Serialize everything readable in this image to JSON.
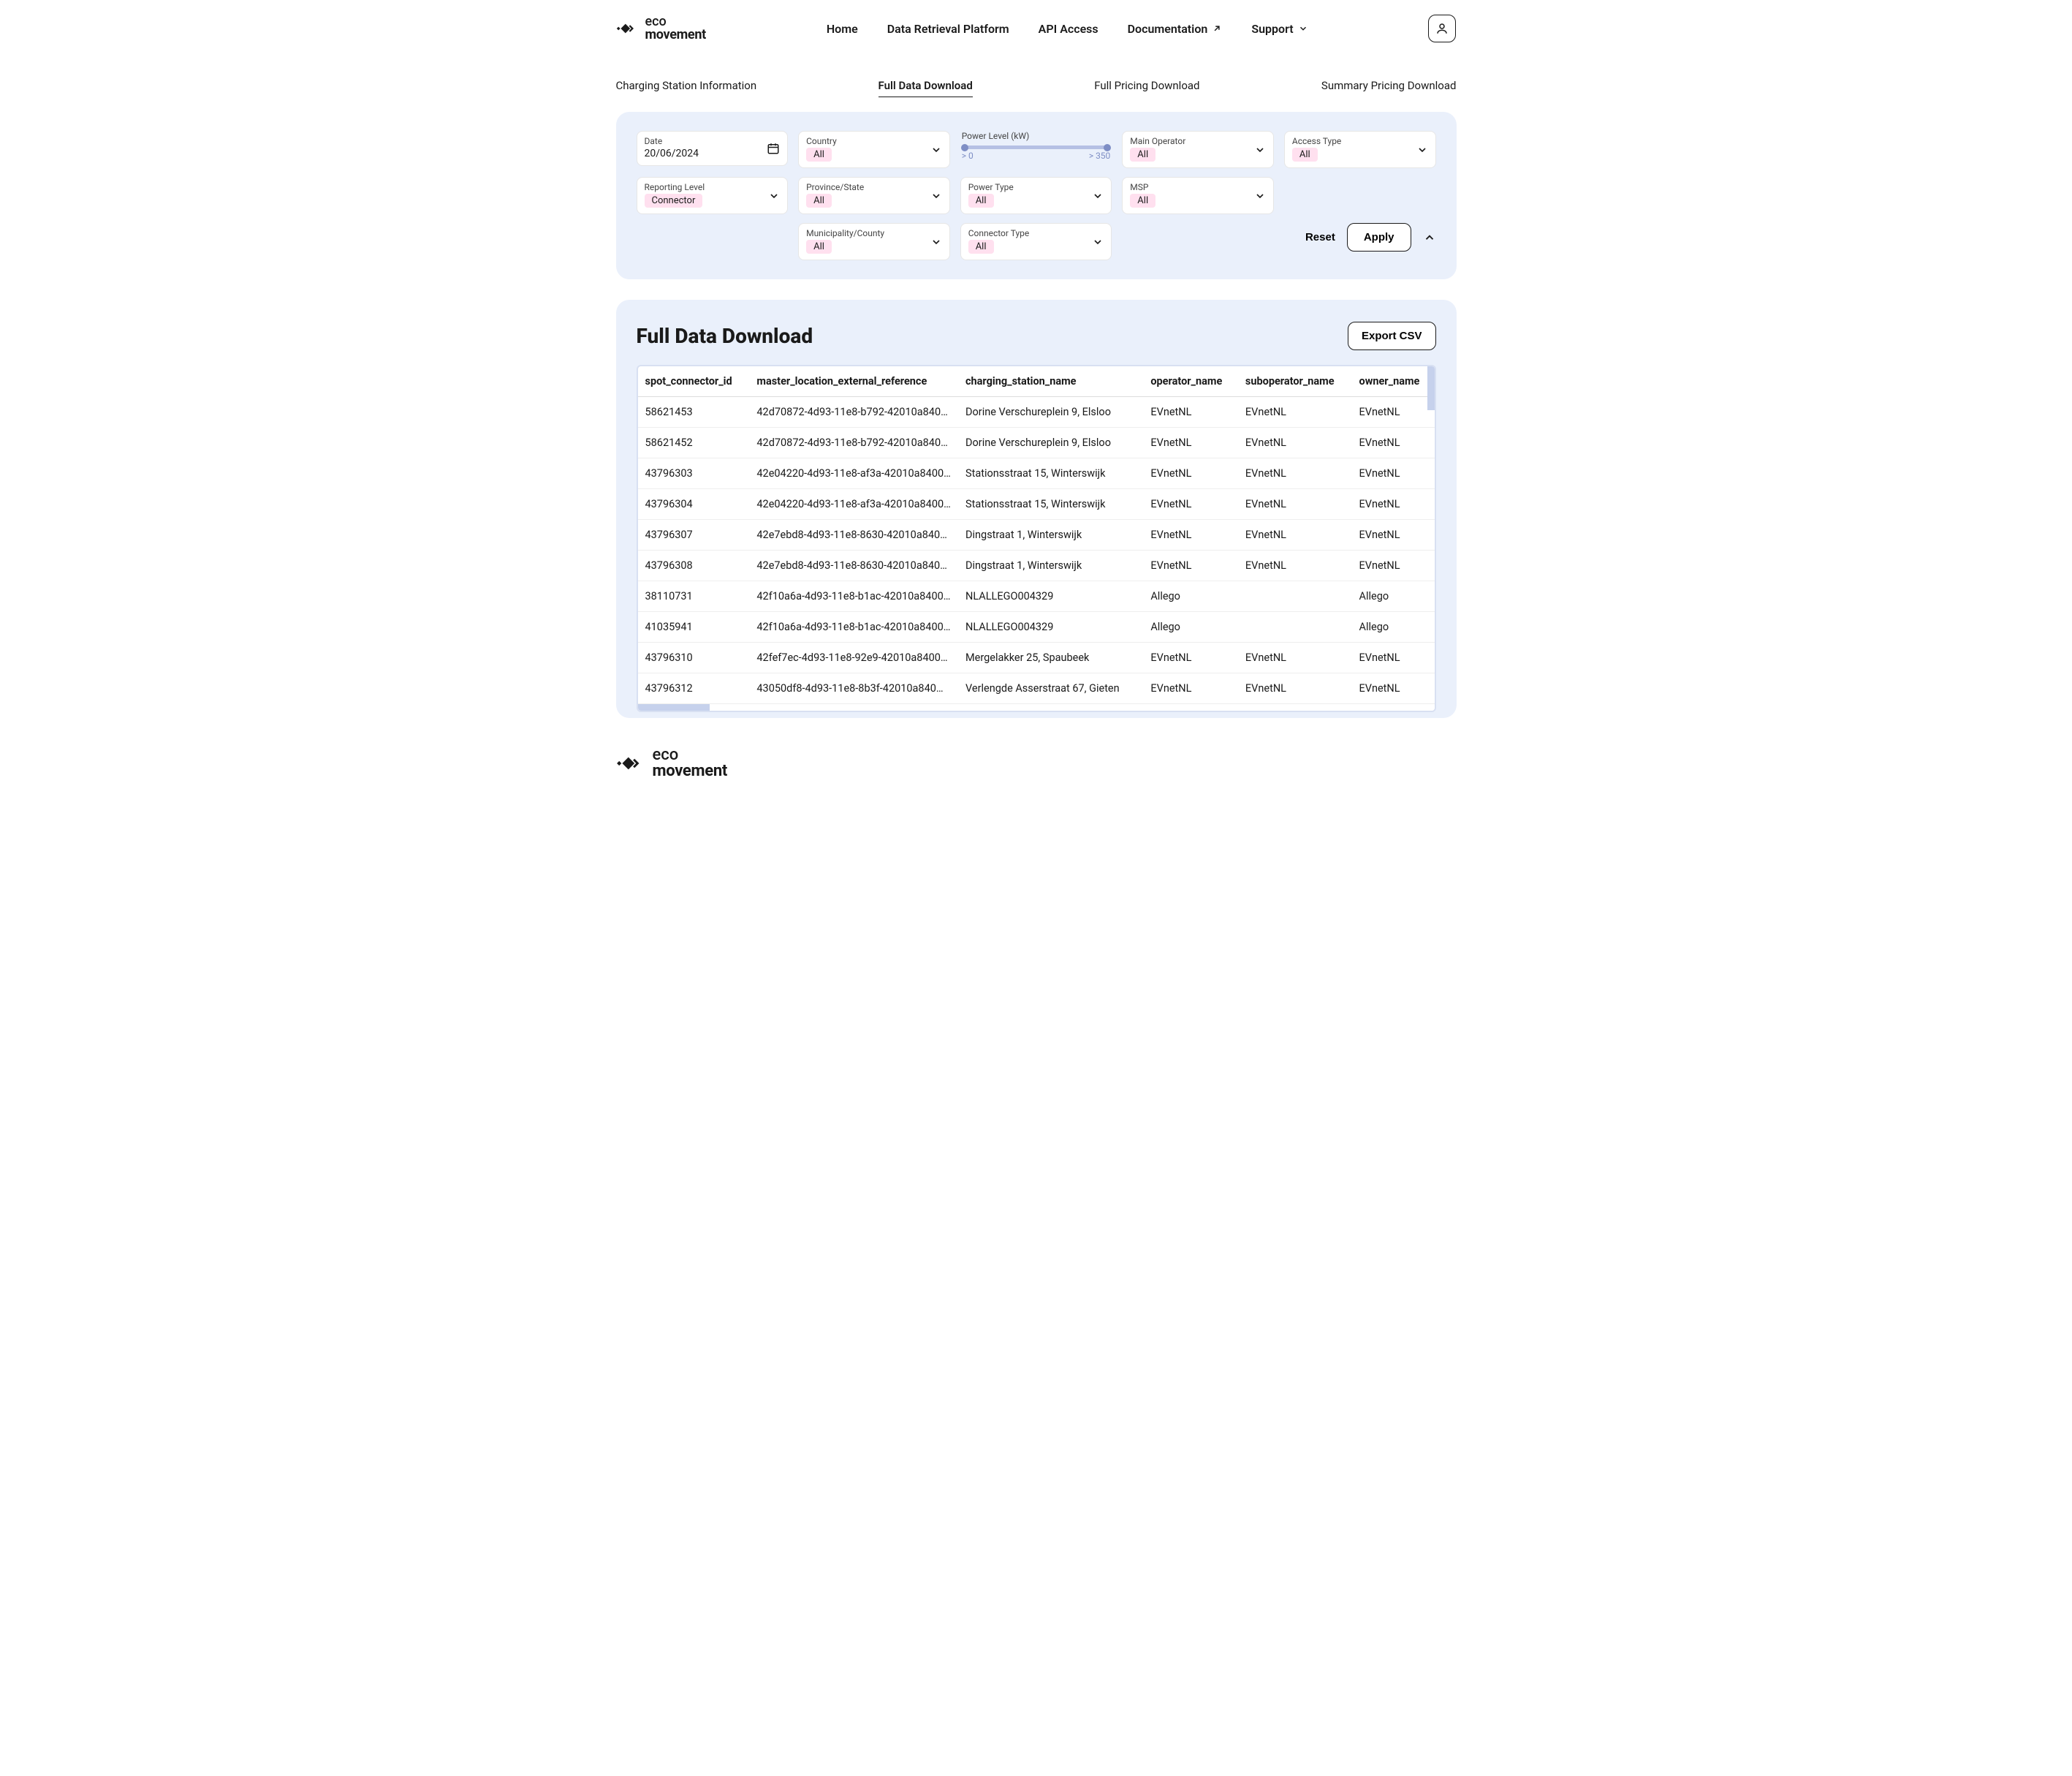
{
  "brand": {
    "line1": "eco",
    "line2": "movement"
  },
  "nav": {
    "home": "Home",
    "drp": "Data Retrieval Platform",
    "api": "API Access",
    "docs": "Documentation",
    "support": "Support"
  },
  "subnav": {
    "csi": "Charging Station Information",
    "full_data": "Full Data Download",
    "full_pricing": "Full Pricing Download",
    "summary_pricing": "Summary Pricing Download"
  },
  "filters": {
    "date": {
      "label": "Date",
      "value": "20/06/2024"
    },
    "reporting_level": {
      "label": "Reporting Level",
      "value": "Connector"
    },
    "country": {
      "label": "Country",
      "value": "All"
    },
    "province": {
      "label": "Province/State",
      "value": "All"
    },
    "municipality": {
      "label": "Municipality/County",
      "value": "All"
    },
    "power_level": {
      "label": "Power Level (kW)",
      "min": "> 0",
      "max": "> 350"
    },
    "power_type": {
      "label": "Power Type",
      "value": "All"
    },
    "connector_type": {
      "label": "Connector Type",
      "value": "All"
    },
    "main_operator": {
      "label": "Main Operator",
      "value": "All"
    },
    "msp": {
      "label": "MSP",
      "value": "All"
    },
    "access_type": {
      "label": "Access Type",
      "value": "All"
    },
    "reset": "Reset",
    "apply": "Apply"
  },
  "data_section": {
    "title": "Full Data Download",
    "export": "Export CSV",
    "columns": {
      "spot_connector_id": "spot_connector_id",
      "master_location_external_reference": "master_location_external_reference",
      "charging_station_name": "charging_station_name",
      "operator_name": "operator_name",
      "suboperator_name": "suboperator_name",
      "owner_name": "owner_name"
    },
    "rows": [
      {
        "id": "58621453",
        "ref": "42d70872-4d93-11e8-b792-42010a840…",
        "name": "Dorine Verschureplein 9, Elsloo",
        "op": "EVnetNL",
        "subop": "EVnetNL",
        "owner": "EVnetNL"
      },
      {
        "id": "58621452",
        "ref": "42d70872-4d93-11e8-b792-42010a840…",
        "name": "Dorine Verschureplein 9, Elsloo",
        "op": "EVnetNL",
        "subop": "EVnetNL",
        "owner": "EVnetNL"
      },
      {
        "id": "43796303",
        "ref": "42e04220-4d93-11e8-af3a-42010a8400…",
        "name": "Stationsstraat 15, Winterswijk",
        "op": "EVnetNL",
        "subop": "EVnetNL",
        "owner": "EVnetNL"
      },
      {
        "id": "43796304",
        "ref": "42e04220-4d93-11e8-af3a-42010a8400…",
        "name": "Stationsstraat 15, Winterswijk",
        "op": "EVnetNL",
        "subop": "EVnetNL",
        "owner": "EVnetNL"
      },
      {
        "id": "43796307",
        "ref": "42e7ebd8-4d93-11e8-8630-42010a840…",
        "name": "Dingstraat 1, Winterswijk",
        "op": "EVnetNL",
        "subop": "EVnetNL",
        "owner": "EVnetNL"
      },
      {
        "id": "43796308",
        "ref": "42e7ebd8-4d93-11e8-8630-42010a840…",
        "name": "Dingstraat 1, Winterswijk",
        "op": "EVnetNL",
        "subop": "EVnetNL",
        "owner": "EVnetNL"
      },
      {
        "id": "38110731",
        "ref": "42f10a6a-4d93-11e8-b1ac-42010a8400…",
        "name": "NLALLEGO004329",
        "op": "Allego",
        "subop": "",
        "owner": "Allego"
      },
      {
        "id": "41035941",
        "ref": "42f10a6a-4d93-11e8-b1ac-42010a8400…",
        "name": "NLALLEGO004329",
        "op": "Allego",
        "subop": "",
        "owner": "Allego"
      },
      {
        "id": "43796310",
        "ref": "42fef7ec-4d93-11e8-92e9-42010a8400…",
        "name": "Mergelakker 25, Spaubeek",
        "op": "EVnetNL",
        "subop": "EVnetNL",
        "owner": "EVnetNL"
      },
      {
        "id": "43796312",
        "ref": "43050df8-4d93-11e8-8b3f-42010a840…",
        "name": "Verlengde Asserstraat 67, Gieten",
        "op": "EVnetNL",
        "subop": "EVnetNL",
        "owner": "EVnetNL"
      }
    ]
  }
}
